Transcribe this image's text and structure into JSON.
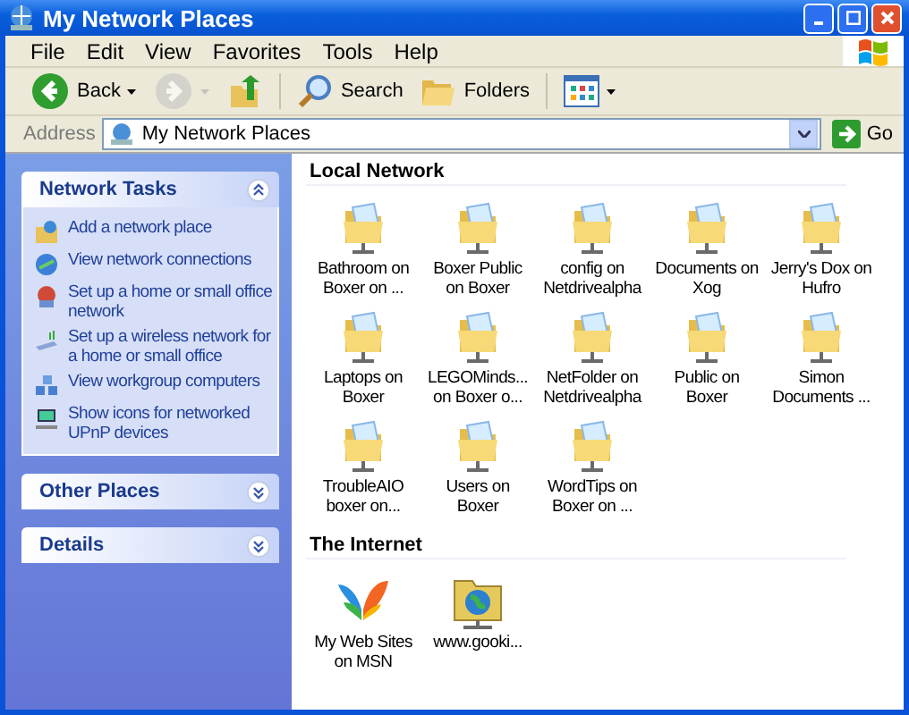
{
  "window": {
    "title": "My Network Places"
  },
  "menu": [
    "File",
    "Edit",
    "View",
    "Favorites",
    "Tools",
    "Help"
  ],
  "toolbar": [
    {
      "kind": "back",
      "label": "Back",
      "disabled": false
    },
    {
      "kind": "forward",
      "disabled": true
    },
    {
      "kind": "up"
    },
    {
      "kind": "search",
      "label": "Search"
    },
    {
      "kind": "folders",
      "label": "Folders"
    },
    {
      "kind": "views"
    }
  ],
  "address": {
    "label": "Address",
    "value": "My Network Places",
    "go": "Go"
  },
  "sidebar": [
    {
      "title": "Network Tasks",
      "expanded": true,
      "items": [
        {
          "kind": "add",
          "label": "Add a network place"
        },
        {
          "kind": "connections",
          "label": "View network connections"
        },
        {
          "kind": "home",
          "label": "Set up a home or small office network"
        },
        {
          "kind": "wireless",
          "label": "Set up a wireless network for a home or small office"
        },
        {
          "kind": "workgroup",
          "label": "View workgroup computers"
        },
        {
          "kind": "upnp",
          "label": "Show icons for networked UPnP devices"
        }
      ]
    },
    {
      "title": "Other Places",
      "expanded": false
    },
    {
      "title": "Details",
      "expanded": false
    }
  ],
  "groups": [
    {
      "title": "Local Network",
      "items": [
        {
          "kind": "share",
          "lines": [
            "Bathroom on",
            "Boxer on ..."
          ]
        },
        {
          "kind": "share",
          "lines": [
            "Boxer Public",
            "on Boxer"
          ]
        },
        {
          "kind": "share",
          "lines": [
            "config on",
            "Netdrivealpha"
          ]
        },
        {
          "kind": "share",
          "lines": [
            "Documents on",
            "Xog"
          ]
        },
        {
          "kind": "share",
          "lines": [
            "Jerry's Dox on",
            "Hufro"
          ]
        },
        {
          "kind": "share",
          "lines": [
            "Laptops on",
            "Boxer"
          ]
        },
        {
          "kind": "share",
          "lines": [
            "LEGOMinds...",
            "on Boxer o..."
          ]
        },
        {
          "kind": "share",
          "lines": [
            "NetFolder on",
            "Netdrivealpha"
          ]
        },
        {
          "kind": "share",
          "lines": [
            "Public on",
            "Boxer"
          ]
        },
        {
          "kind": "share",
          "lines": [
            "Simon",
            "Documents ..."
          ]
        },
        {
          "kind": "share",
          "lines": [
            "TroubleAIO",
            "boxer on..."
          ]
        },
        {
          "kind": "share",
          "lines": [
            "Users on",
            "Boxer"
          ]
        },
        {
          "kind": "share",
          "lines": [
            "WordTips on",
            "Boxer on ..."
          ]
        }
      ]
    },
    {
      "title": "The Internet",
      "items": [
        {
          "kind": "msn",
          "lines": [
            "My Web Sites",
            "on MSN"
          ]
        },
        {
          "kind": "web",
          "lines": [
            "www.gooki..."
          ]
        }
      ]
    }
  ]
}
